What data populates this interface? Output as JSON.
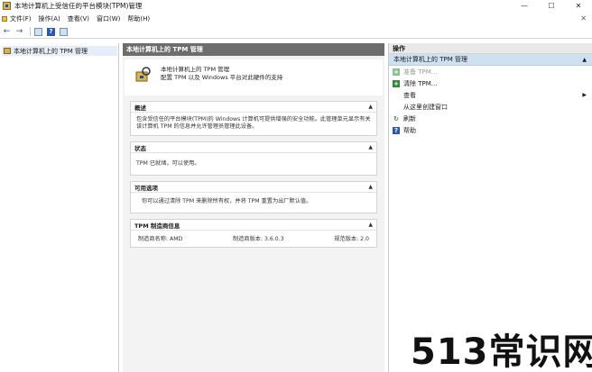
{
  "window": {
    "title": "本地计算机上受信任的平台模块(TPM)管理",
    "controls": {
      "minimize": "—",
      "maximize": "☐",
      "close": "✕"
    }
  },
  "menubar": {
    "items": [
      {
        "label": "文件(F)"
      },
      {
        "label": "操作(A)"
      },
      {
        "label": "查看(V)"
      },
      {
        "label": "窗口(W)"
      },
      {
        "label": "帮助(H)"
      }
    ],
    "right_close": "✕"
  },
  "toolbar": {
    "back_icon": "arrow-left-icon",
    "forward_icon": "arrow-right-icon",
    "back_glyph": "←",
    "forward_glyph": "→",
    "help_glyph": "?"
  },
  "tree": {
    "items": [
      {
        "label": "本地计算机上的 TPM 管理"
      }
    ]
  },
  "center": {
    "header": "本地计算机上的 TPM 管理",
    "intro": {
      "line1": "本地计算机上的 TPM 管理",
      "line2": "配置 TPM 以及 Windows 平台对此硬件的支持"
    },
    "sections": {
      "overview": {
        "title": "概述",
        "body": "包含受信任的平台模块(TPM)的 Windows 计算机可提供增强的安全功能。此管理单元显示有关该计算机 TPM 的信息并允许管理员管理此设备。"
      },
      "status": {
        "title": "状态",
        "body": "TPM 已就绪，可以使用。"
      },
      "options": {
        "title": "可用选项",
        "body": "你可以通过清除 TPM 来删除所有权，并将 TPM 重置为出厂默认值。"
      },
      "manufacturer": {
        "title": "TPM 制造商信息",
        "name": "制造商名称: AMD",
        "version": "制造商版本: 3.6.0.3",
        "spec": "规范版本: 2.0"
      }
    },
    "caret": "▲"
  },
  "actions": {
    "header": "操作",
    "sub_header": "本地计算机上的 TPM 管理",
    "sub_arrow": "▲",
    "items": [
      {
        "label": "准备 TPM...",
        "enabled": false
      },
      {
        "label": "清除 TPM...",
        "enabled": true
      },
      {
        "label": "查看",
        "enabled": true,
        "submenu": "▶"
      },
      {
        "label": "从这里创建窗口",
        "enabled": true
      },
      {
        "label": "刷新",
        "enabled": true
      },
      {
        "label": "帮助",
        "enabled": true
      }
    ],
    "plus_glyph": "+",
    "refresh_glyph": "↻",
    "help_glyph": "?"
  },
  "watermark": "513常识网",
  "colors": {
    "header_gray": "#6d6d6d",
    "action_highlight": "#cfe0f1",
    "green": "#2e8b3a"
  }
}
